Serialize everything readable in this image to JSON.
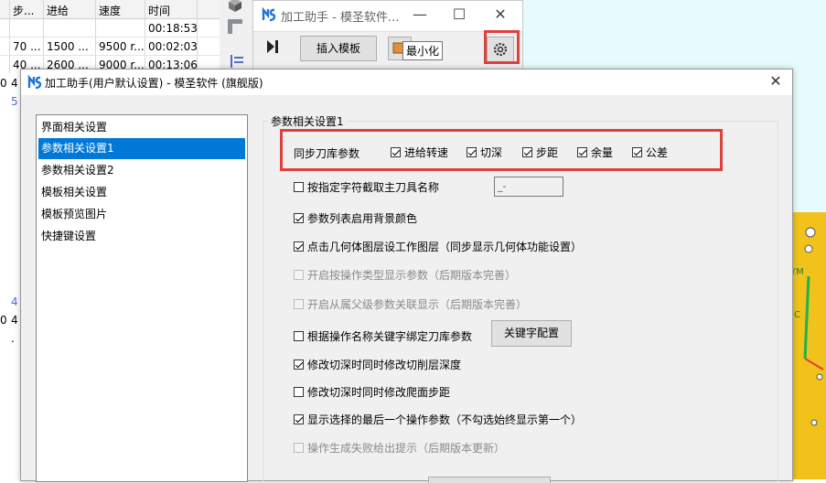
{
  "background_table": {
    "headers": [
      "步...",
      "进给",
      "速度",
      "时间"
    ],
    "rows": [
      {
        "c0": "",
        "c1": "",
        "c2": "",
        "c3": "00:18:53"
      },
      {
        "c0": "70 ...",
        "c1": "1500 ...",
        "c2": "9500 r...",
        "c3": "00:02:03"
      },
      {
        "c0": "40 ...",
        "c1": "2600 ...",
        "c2": "9000 r...",
        "c3": "00:13:06"
      }
    ],
    "side_fragments": [
      "0",
      "4",
      "5",
      "4",
      "0",
      "4",
      "."
    ]
  },
  "helper_window": {
    "title": "加工助手 - 模圣软件...",
    "minimize_glyph": "—",
    "maximize_glyph": "☐",
    "close_glyph": "✕",
    "insert_template_label": "插入模板",
    "minimize_tooltip": "最小化",
    "settings_icon": "gear-icon"
  },
  "dialog": {
    "title": "加工助手(用户默认设置) - 模圣软件 (旗舰版)",
    "close_glyph": "✕",
    "nav_items": [
      {
        "label": "界面相关设置",
        "selected": false
      },
      {
        "label": "参数相关设置1",
        "selected": true
      },
      {
        "label": "参数相关设置2",
        "selected": false
      },
      {
        "label": "模板相关设置",
        "selected": false
      },
      {
        "label": "模板预览图片",
        "selected": false
      },
      {
        "label": "快捷键设置",
        "selected": false
      }
    ],
    "group_title": "参数相关设置1",
    "sync_label": "同步刀库参数",
    "sync_options": [
      {
        "label": "进给转速",
        "checked": true
      },
      {
        "label": "切深",
        "checked": true
      },
      {
        "label": "步距",
        "checked": true
      },
      {
        "label": "余量",
        "checked": true
      },
      {
        "label": "公差",
        "checked": true
      }
    ],
    "options": [
      {
        "label": "按指定字符截取主刀具名称",
        "checked": false,
        "disabled": false
      },
      {
        "label": "参数列表启用背景颜色",
        "checked": true,
        "disabled": false
      },
      {
        "label": "点击几何体图层设工作图层（同步显示几何体功能设置）",
        "checked": true,
        "disabled": false
      },
      {
        "label": "开启按操作类型显示参数（后期版本完善）",
        "checked": false,
        "disabled": true
      },
      {
        "label": "开启从属父级参数关联显示（后期版本完善）",
        "checked": false,
        "disabled": true
      },
      {
        "label": "根据操作名称关键字绑定刀库参数",
        "checked": false,
        "disabled": false
      },
      {
        "label": "修改切深时同时修改切削层深度",
        "checked": true,
        "disabled": false
      },
      {
        "label": "修改切深时同时修改爬面步距",
        "checked": false,
        "disabled": false
      },
      {
        "label": "显示选择的最后一个操作参数（不勾选始终显示第一个）",
        "checked": true,
        "disabled": false
      },
      {
        "label": "操作生成失败给出提示（后期版本更新）",
        "checked": false,
        "disabled": true
      }
    ],
    "name_char_value": "_-",
    "keyword_config_label": "关键字配置"
  },
  "colors": {
    "selection": "#0078d7",
    "highlight_red": "#e0403a",
    "brand_blue": "#1e73d8"
  }
}
